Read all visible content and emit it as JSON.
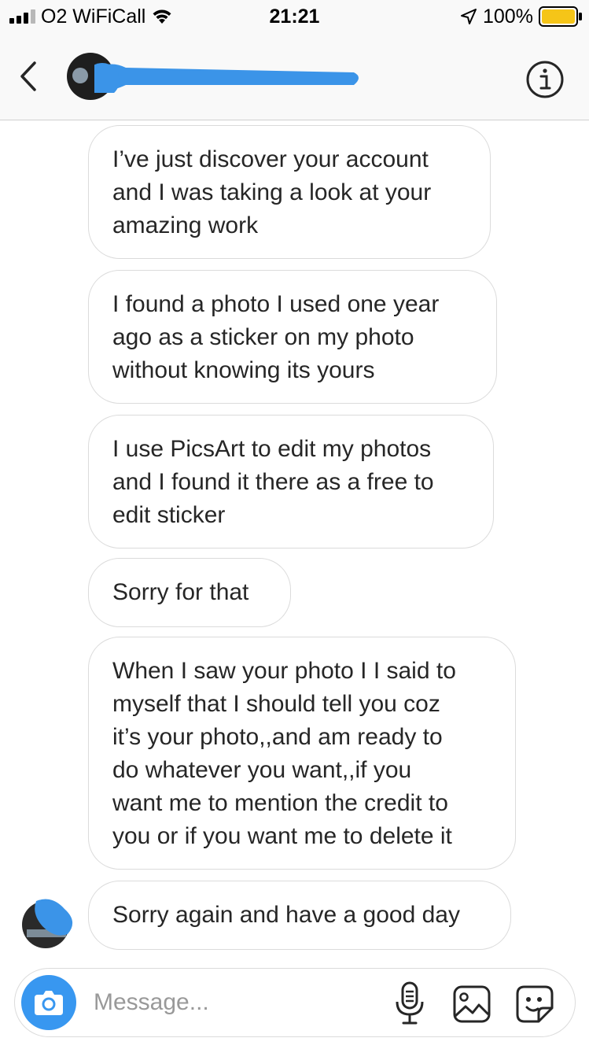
{
  "status_bar": {
    "carrier": "O2 WiFiCall",
    "time": "21:21",
    "battery_percent": "100%",
    "battery_color": "#f5c518",
    "icons": [
      "signal-bars-icon",
      "wifi-icon",
      "location-arrow-icon",
      "battery-icon"
    ]
  },
  "header": {
    "icons": [
      "back-chevron-icon",
      "info-icon"
    ],
    "redaction_color": "#3b94e8"
  },
  "messages": [
    {
      "text": "I’ve just discover your account\nand I was taking a look at your\namazing work"
    },
    {
      "text": "I found a photo I used one year\nago as a sticker on my photo\nwithout knowing its yours"
    },
    {
      "text": "I use PicsArt to edit my photos\nand I found it there as a free to\nedit sticker"
    },
    {
      "text": "Sorry for that"
    },
    {
      "text": "When I saw your photo I I said to\nmyself that I should tell you coz\nit’s your photo,,and am ready to\ndo whatever you want,,if you\nwant me to mention the credit to\nyou or if you want me to delete it"
    },
    {
      "text": "Sorry again and have a good day"
    }
  ],
  "composer": {
    "placeholder": "Message...",
    "value": "",
    "camera_color": "#3897f0",
    "icons": [
      "camera-icon",
      "microphone-icon",
      "gallery-icon",
      "sticker-icon"
    ]
  }
}
